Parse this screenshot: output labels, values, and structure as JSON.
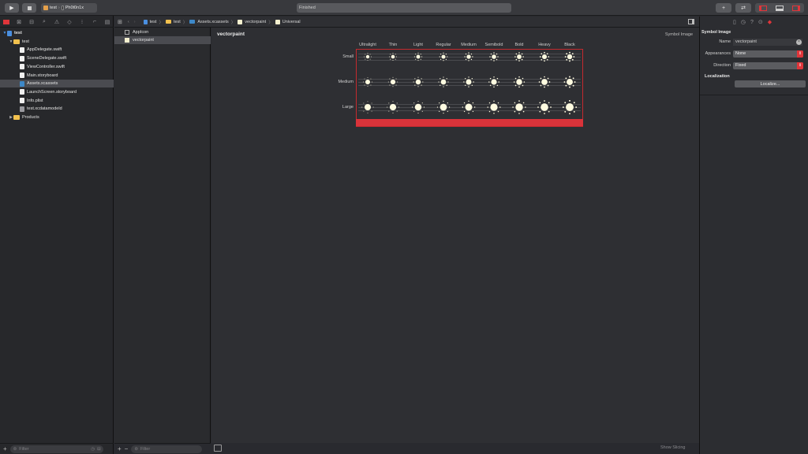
{
  "toolbar": {
    "scheme": "test",
    "device": "Ph0t0n1x",
    "status": "Finished"
  },
  "navigator": {
    "items": [
      {
        "label": "test",
        "kind": "project",
        "level": 0,
        "open": true
      },
      {
        "label": "test",
        "kind": "folder",
        "level": 1,
        "open": true
      },
      {
        "label": "AppDelegate.swift",
        "kind": "swift",
        "level": 2
      },
      {
        "label": "SceneDelegate.swift",
        "kind": "swift",
        "level": 2
      },
      {
        "label": "ViewController.swift",
        "kind": "swift",
        "level": 2
      },
      {
        "label": "Main.storyboard",
        "kind": "storyboard",
        "level": 2
      },
      {
        "label": "Assets.xcassets",
        "kind": "assets",
        "level": 2,
        "selected": true
      },
      {
        "label": "LaunchScreen.storyboard",
        "kind": "storyboard",
        "level": 2
      },
      {
        "label": "Info.plist",
        "kind": "plist",
        "level": 2
      },
      {
        "label": "test.xcdatamodeld",
        "kind": "datamodel",
        "level": 2
      },
      {
        "label": "Products",
        "kind": "folder",
        "level": 1,
        "open": false
      }
    ],
    "filter_placeholder": "Filter"
  },
  "assets": {
    "items": [
      {
        "label": "AppIcon"
      },
      {
        "label": "vectorpaint",
        "selected": true
      }
    ],
    "filter_placeholder": "Filter"
  },
  "jumpbar": {
    "crumbs": [
      "test",
      "test",
      "Assets.xcassets",
      "vectorpaint",
      "Universal"
    ]
  },
  "editor": {
    "title": "vectorpaint",
    "type_label": "Symbol Image",
    "weights": [
      "Ultralight",
      "Thin",
      "Light",
      "Regular",
      "Medium",
      "Semibold",
      "Bold",
      "Heavy",
      "Black"
    ],
    "scales": [
      "Small",
      "Medium",
      "Large"
    ],
    "show_slicing": "Show Slicing"
  },
  "inspector": {
    "section": "Symbol Image",
    "name_label": "Name",
    "name_value": "vectorpaint",
    "appearances_label": "Appearances",
    "appearances_value": "None",
    "direction_label": "Direction",
    "direction_value": "Fixed",
    "localization_label": "Localization",
    "localize_button": "Localize..."
  },
  "colors": {
    "accent": "#e0353a",
    "folder": "#f2c14e",
    "selection": "#4a4b50"
  }
}
